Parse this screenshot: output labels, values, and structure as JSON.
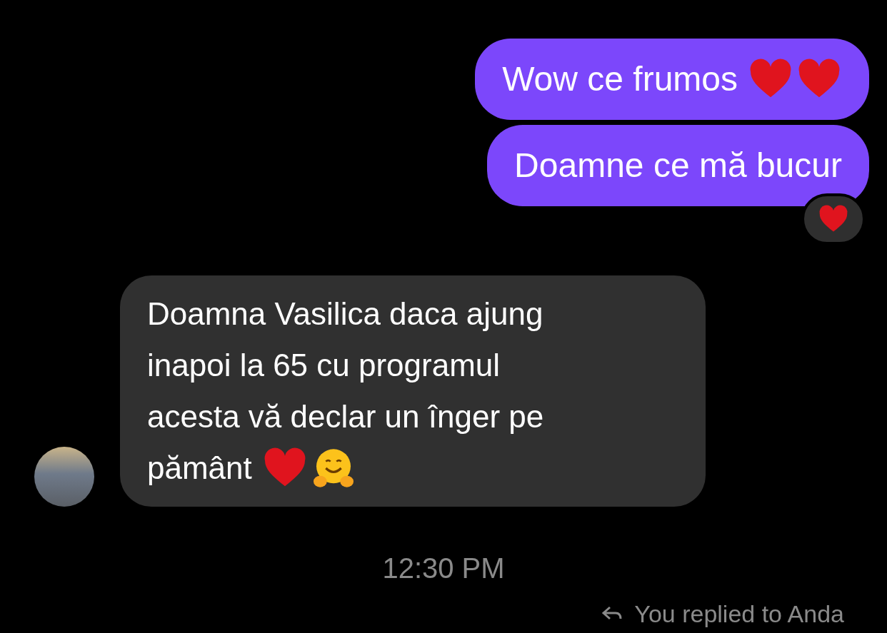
{
  "messages": [
    {
      "kind": "outgoing",
      "lines": [
        "Wow ce frumos"
      ],
      "emoji": [
        {
          "kind": "heart"
        },
        {
          "kind": "heart"
        }
      ]
    },
    {
      "kind": "outgoing",
      "lines": [
        "Doamne ce mă bucur"
      ],
      "reaction": {
        "kind": "heart"
      }
    },
    {
      "kind": "incoming",
      "lines": [
        "Doamna Vasilica daca ajung",
        "inapoi la 65 cu programul",
        "acesta vă declar un înger pe",
        "pământ"
      ],
      "emoji": [
        {
          "kind": "heart"
        },
        {
          "kind": "hug"
        }
      ]
    }
  ],
  "timestamp": "12:30 PM",
  "reply_note": "You replied to Anda"
}
